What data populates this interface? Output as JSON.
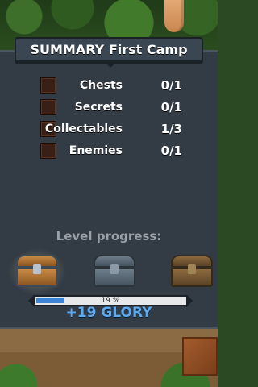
{
  "header": {
    "title": "SUMMARY First Camp"
  },
  "stats": [
    {
      "label": "Chests",
      "value": "0/1",
      "checked": false
    },
    {
      "label": "Secrets",
      "value": "0/1",
      "checked": false
    },
    {
      "label": "Collectables",
      "value": "1/3",
      "checked": false
    },
    {
      "label": "Enemies",
      "value": "0/1",
      "checked": false
    }
  ],
  "progress": {
    "heading": "Level progress:",
    "percent_label": "19 %",
    "fraction": 0.19,
    "chests": [
      "bronze-chest",
      "silver-chest",
      "gold-chest"
    ]
  },
  "reward": {
    "glory_label": "+19 GLORY"
  },
  "colors": {
    "panel": "#333c45",
    "accent": "#5da9ef",
    "bar_fill": "#3c85d6"
  }
}
